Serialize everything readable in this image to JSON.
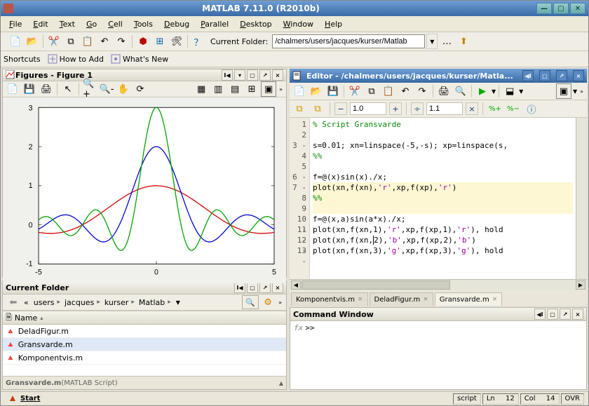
{
  "window": {
    "title": "MATLAB  7.11.0  (R2010b)"
  },
  "menubar": [
    "File",
    "Edit",
    "Text",
    "Go",
    "Cell",
    "Tools",
    "Debug",
    "Parallel",
    "Desktop",
    "Window",
    "Help"
  ],
  "toolbar": {
    "current_folder_label": "Current Folder:",
    "path": "/chalmers/users/jacques/kurser/Matlab"
  },
  "quicklinks": {
    "shortcuts": "Shortcuts",
    "how_to_add": "How to Add",
    "whats_new": "What's New"
  },
  "figures": {
    "title": "Figures - Figure 1"
  },
  "current_folder": {
    "title": "Current Folder",
    "breadcrumbs": [
      "users",
      "jacques",
      "kurser",
      "Matlab"
    ],
    "name_col": "Name",
    "files": [
      "DeladFigur.m",
      "Gransvarde.m",
      "Komponentvis.m"
    ],
    "selected": "Gransvarde.m",
    "status_file": "Gransvarde.m",
    "status_type": " (MATLAB Script)"
  },
  "editor": {
    "title": "Editor - /chalmers/users/jacques/kurser/Matla...",
    "cell_zoom": "1.0",
    "cell_step": "1.1",
    "tabs": [
      {
        "label": "Komponentvis.m",
        "active": false
      },
      {
        "label": "DeladFigur.m",
        "active": false
      },
      {
        "label": "Gransvarde.m",
        "active": true
      }
    ],
    "code": {
      "lines": [
        {
          "n": 1,
          "mark": "",
          "html": "<span class='comment'>% Script Gransvarde</span>"
        },
        {
          "n": 2,
          "mark": "",
          "html": ""
        },
        {
          "n": 3,
          "mark": "-",
          "html": "s=0.01; xn=linspace(-5,-s); xp=linspace(s,"
        },
        {
          "n": 4,
          "mark": "",
          "html": "<span class='cellmark'>%%</span>"
        },
        {
          "n": 5,
          "mark": "",
          "html": ""
        },
        {
          "n": 6,
          "mark": "-",
          "html": "f=@(x)sin(x)./x;"
        },
        {
          "n": 7,
          "mark": "-",
          "html": "plot(xn,f(xn),<span class='string'>'r'</span>,xp,f(xp),<span class='string'>'r'</span>)",
          "active": true
        },
        {
          "n": 8,
          "mark": "",
          "html": "<span class='cellmark'>%%</span>",
          "active": true
        },
        {
          "n": 9,
          "mark": "",
          "html": "",
          "active": true
        },
        {
          "n": 10,
          "mark": "-",
          "html": "f=@(x,a)sin(a*x)./x;"
        },
        {
          "n": 11,
          "mark": "-",
          "html": "plot(xn,f(xn,1),<span class='string'>'r'</span>,xp,f(xp,1),<span class='string'>'r'</span>), hold"
        },
        {
          "n": 12,
          "mark": "-",
          "html": "plot(xn,f(xn,<span style='border-left:1px solid black'>2</span>),<span class='string'>'b'</span>,xp,f(xp,2),<span class='string'>'b'</span>)"
        },
        {
          "n": 13,
          "mark": "-",
          "html": "plot(xn,f(xn,3),<span class='string'>'g'</span>,xp,f(xp,3),<span class='string'>'g'</span>), hold"
        }
      ]
    }
  },
  "command_window": {
    "title": "Command Window",
    "prompt": ">>"
  },
  "statusbar": {
    "start": "Start",
    "mode": "script",
    "line_lbl": "Ln",
    "line_val": "12",
    "col_lbl": "Col",
    "col_val": "14",
    "ovr": "OVR"
  },
  "chart_data": {
    "type": "line",
    "xlim": [
      -5,
      5
    ],
    "ylim": [
      -1,
      3
    ],
    "xlabel": "",
    "ylabel": "",
    "title": "",
    "series": [
      {
        "name": "sin(x)/x",
        "color": "#d00000",
        "note": "amplitude≈1 at x=0, zero crossings at ±π, ±2π, ..."
      },
      {
        "name": "sin(2x)/x",
        "color": "#0000d0",
        "note": "amplitude≈2 at x=0, oscillates twice as fast"
      },
      {
        "name": "sin(3x)/x",
        "color": "#00a000",
        "note": "amplitude≈3 at x=0, oscillates three times as fast"
      }
    ],
    "xticks": [
      -5,
      0,
      5
    ],
    "yticks": [
      -1,
      0,
      1,
      2,
      3
    ],
    "grid": false,
    "box": true
  }
}
